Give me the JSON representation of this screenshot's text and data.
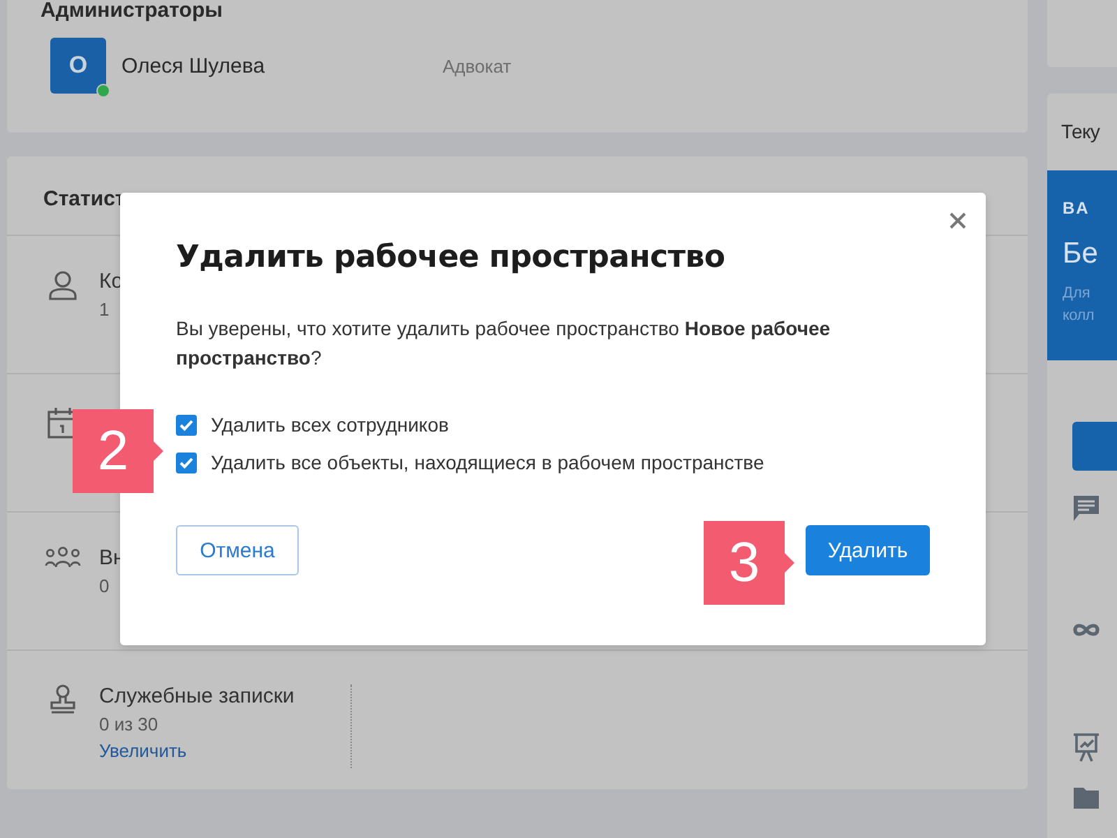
{
  "admins": {
    "title": "Администраторы",
    "members": [
      {
        "initial": "О",
        "name": "Олеся Шулева",
        "role": "Адвокат",
        "online": true
      }
    ]
  },
  "statistics": {
    "title": "Статист",
    "rows": [
      {
        "kind": "stat",
        "label": "Ко",
        "value": "1"
      },
      {
        "kind": "stat"
      },
      {
        "kind": "stat",
        "label": "Вн",
        "value": "0"
      },
      {
        "kind": "quota",
        "label": "Служебные записки",
        "value": "0 из 30",
        "link": "Увеличить"
      }
    ]
  },
  "right_panel": {
    "title": "Теку",
    "banner": {
      "eyebrow": "BA",
      "heading": "Бе",
      "lines": [
        "Для",
        "колл"
      ]
    }
  },
  "dialog": {
    "title": "Удалить рабочее пространство",
    "message": "Вы уверены, что хотите удалить рабочее пространство **Новое рабочее пространство**?",
    "options": [
      {
        "label": "Удалить всех сотрудников",
        "checked": true
      },
      {
        "label": "Удалить все объекты, находящиеся в рабочем пространстве",
        "checked": true
      }
    ],
    "cancel": "Отмена",
    "confirm": "Удалить"
  },
  "annotations": [
    {
      "number": "2"
    },
    {
      "number": "3"
    }
  ]
}
